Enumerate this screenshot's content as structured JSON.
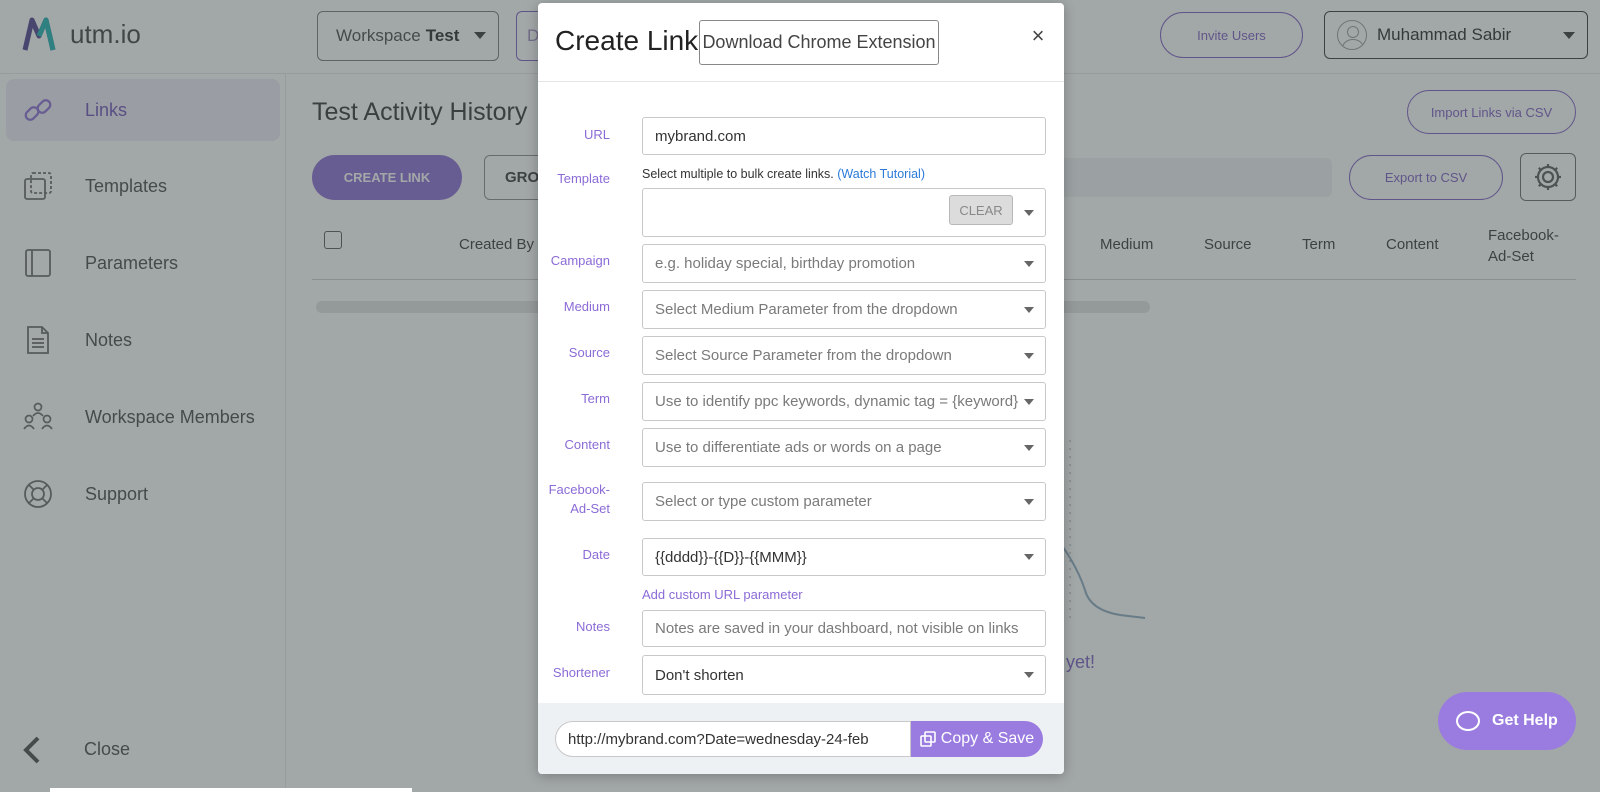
{
  "app": {
    "name": "utm.io"
  },
  "header": {
    "workspace_prefix": "Workspace",
    "workspace_name": "Test",
    "domain_partial": "D",
    "invite_label": "Invite Users",
    "user_name": "Muhammad Sabir"
  },
  "sidebar": {
    "items": [
      {
        "label": "Links",
        "icon": "link-icon",
        "active": true
      },
      {
        "label": "Templates",
        "icon": "templates-icon"
      },
      {
        "label": "Parameters",
        "icon": "parameters-icon"
      },
      {
        "label": "Notes",
        "icon": "notes-icon"
      },
      {
        "label": "Workspace Members",
        "icon": "members-icon"
      },
      {
        "label": "Support",
        "icon": "support-icon"
      }
    ],
    "close_label": "Close"
  },
  "main": {
    "title": "Test Activity History",
    "import_label": "Import Links via CSV",
    "create_label": "CREATE LINK",
    "group_label": "GRO",
    "export_label": "Export to CSV",
    "columns": [
      "Created By",
      "Medium",
      "Source",
      "Term",
      "Content",
      "Facebook-Ad-Set"
    ],
    "empty_text_partial": "yet!"
  },
  "modal": {
    "title": "Create Link",
    "chrome_label": "Download Chrome Extension",
    "close_symbol": "×",
    "url": {
      "label": "URL",
      "value": "mybrand.com"
    },
    "template": {
      "label": "Template",
      "hint": "Select multiple to bulk create links.",
      "hint_link": "(Watch Tutorial)",
      "clear_label": "CLEAR"
    },
    "campaign": {
      "label": "Campaign",
      "placeholder": "e.g. holiday special, birthday promotion"
    },
    "medium": {
      "label": "Medium",
      "placeholder": "Select Medium Parameter from the dropdown"
    },
    "source": {
      "label": "Source",
      "placeholder": "Select Source Parameter from the dropdown"
    },
    "term": {
      "label": "Term",
      "placeholder": "Use to identify ppc keywords, dynamic tag = {keyword}"
    },
    "content": {
      "label": "Content",
      "placeholder": "Use to differentiate ads or words on a page"
    },
    "facebook": {
      "label_line1": "Facebook-",
      "label_line2": "Ad-Set",
      "placeholder": "Select or type custom parameter"
    },
    "date": {
      "label": "Date",
      "value": "{{dddd}}-{{D}}-{{MMM}}"
    },
    "add_param_label": "Add custom URL parameter",
    "notes": {
      "label": "Notes",
      "placeholder": "Notes are saved in your dashboard, not visible on links"
    },
    "shortener": {
      "label": "Shortener",
      "value": "Don't shorten"
    },
    "output_url": "http://mybrand.com?Date=wednesday-24-feb",
    "copy_label": "Copy & Save"
  },
  "help": {
    "label": "Get Help"
  },
  "colors": {
    "accent": "#8b6bd6",
    "link_blue": "#2b7ad8",
    "overlay": "rgba(70,80,80,0.5)"
  }
}
